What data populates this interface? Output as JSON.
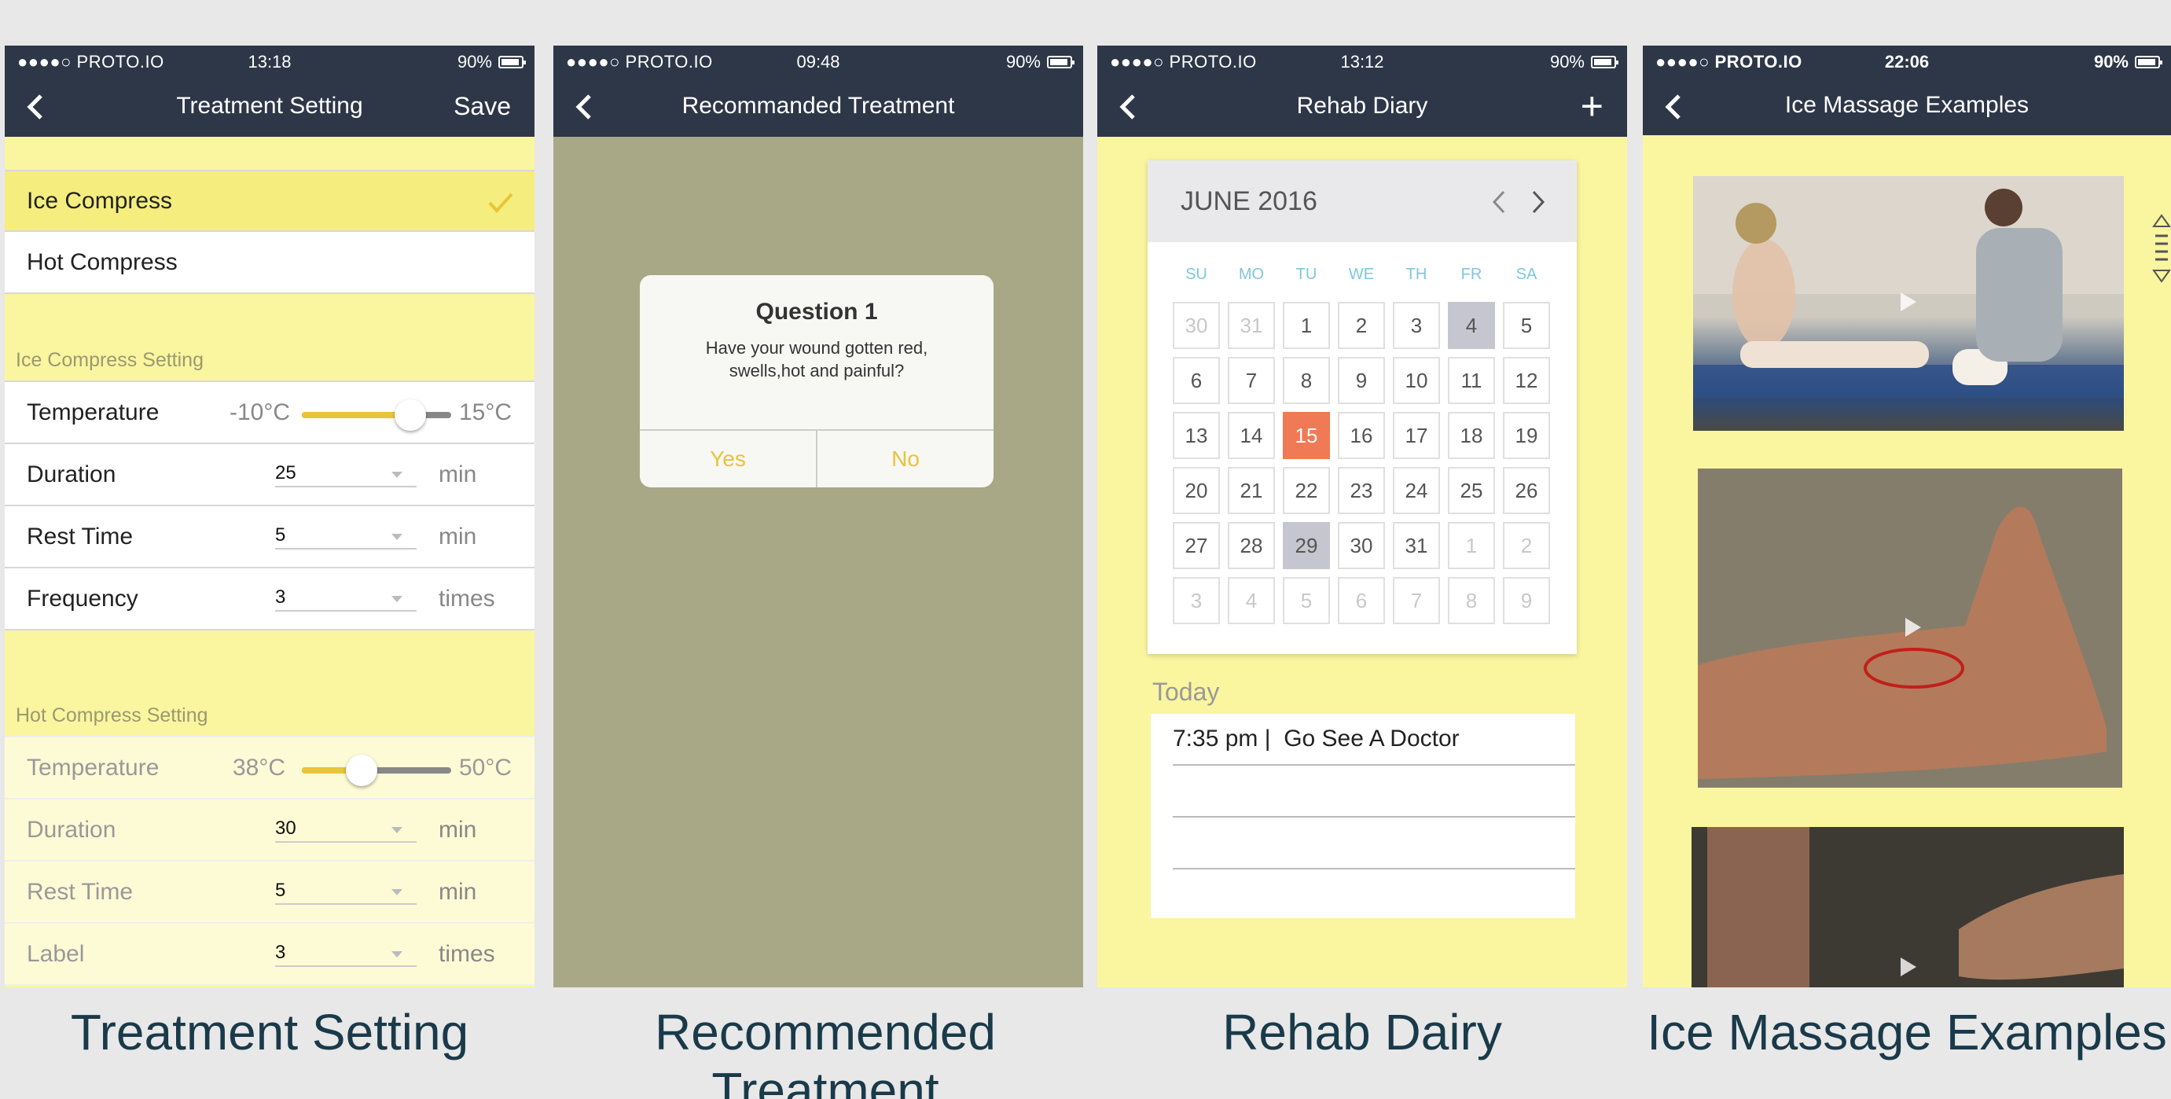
{
  "colors": {
    "navbar": "#2d3748",
    "accent_yellow": "#e8c43a",
    "panel_yellow": "#faf59f",
    "today": "#f07a55"
  },
  "panel1": {
    "status": {
      "carrier": "●●●●○ PROTO.IO",
      "time": "13:18",
      "battery": "90%"
    },
    "title": "Treatment Setting",
    "right": "Save",
    "options": [
      {
        "label": "Ice Compress",
        "selected": true
      },
      {
        "label": "Hot Compress",
        "selected": false
      }
    ],
    "ice": {
      "section": "Ice Compress Setting",
      "temperature": {
        "label": "Temperature",
        "min": "-10°C",
        "max": "15°C",
        "level": 0.72
      },
      "duration": {
        "label": "Duration",
        "value": "25",
        "unit": "min"
      },
      "rest": {
        "label": "Rest Time",
        "value": "5",
        "unit": "min"
      },
      "frequency": {
        "label": "Frequency",
        "value": "3",
        "unit": "times"
      }
    },
    "hot": {
      "section": "Hot Compress Setting",
      "temperature": {
        "label": "Temperature",
        "min": "38°C",
        "max": "50°C",
        "level": 0.4
      },
      "duration": {
        "label": "Duration",
        "value": "30",
        "unit": "min"
      },
      "rest": {
        "label": "Rest Time",
        "value": "5",
        "unit": "min"
      },
      "frequency": {
        "label": "Label",
        "value": "3",
        "unit": "times"
      }
    },
    "caption": "Treatment Setting"
  },
  "panel2": {
    "status": {
      "carrier": "●●●●○ PROTO.IO",
      "time": "09:48",
      "battery": "90%"
    },
    "title": "Recommanded Treatment",
    "dialog": {
      "title": "Question 1",
      "text": "Have your wound gotten red, swells,hot and painful?",
      "yes": "Yes",
      "no": "No"
    },
    "caption": "Recommended Treatment"
  },
  "panel3": {
    "status": {
      "carrier": "●●●●○ PROTO.IO",
      "time": "13:12",
      "battery": "90%"
    },
    "title": "Rehab Diary",
    "right": "+",
    "calendar": {
      "month": "JUNE 2016",
      "dow": [
        "SU",
        "MO",
        "TU",
        "WE",
        "TH",
        "FR",
        "SA"
      ],
      "days": [
        "30",
        "31",
        "1",
        "2",
        "3",
        "4",
        "5",
        "6",
        "7",
        "8",
        "9",
        "10",
        "11",
        "12",
        "13",
        "14",
        "15",
        "16",
        "17",
        "18",
        "19",
        "20",
        "21",
        "22",
        "23",
        "24",
        "25",
        "26",
        "27",
        "28",
        "29",
        "30",
        "31",
        "1",
        "2",
        "3",
        "4",
        "5",
        "6",
        "7",
        "8",
        "9"
      ]
    },
    "today_label": "Today",
    "entry": "7:35 pm |  Go See A Doctor",
    "caption": "Rehab Dairy"
  },
  "panel4": {
    "status": {
      "carrier": "●●●●○ PROTO.IO",
      "time": "22:06",
      "battery": "90%"
    },
    "title": "Ice Massage Examples",
    "caption": "Ice Massage Examples"
  }
}
